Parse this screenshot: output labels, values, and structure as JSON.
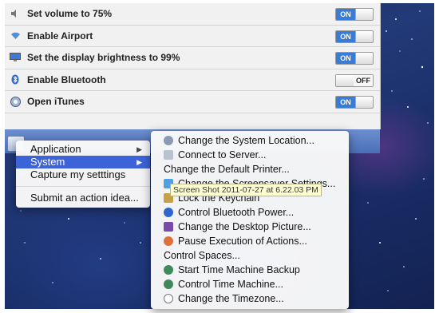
{
  "panel": {
    "rows": [
      {
        "icon": "speaker-icon",
        "label": "Set volume to 75%",
        "toggle": "ON"
      },
      {
        "icon": "airport-icon",
        "label": "Enable Airport",
        "toggle": "ON"
      },
      {
        "icon": "display-icon",
        "label": "Set the display brightness to 99%",
        "toggle": "ON"
      },
      {
        "icon": "bluetooth-icon",
        "label": "Enable Bluetooth",
        "toggle": "OFF"
      },
      {
        "icon": "itunes-icon",
        "label": "Open iTunes",
        "toggle": "ON"
      }
    ]
  },
  "context_menu": {
    "items": [
      {
        "label": "Application",
        "has_submenu": true
      },
      {
        "label": "System",
        "has_submenu": true,
        "selected": true
      },
      {
        "label": "Capture my setttings"
      },
      {
        "label": "Submit an action idea..."
      }
    ]
  },
  "submenu": {
    "items": [
      {
        "label": "Change the System Location...",
        "icon": "network-icon"
      },
      {
        "label": "Connect to Server...",
        "icon": "server-icon"
      },
      {
        "label": "Change the Default Printer..."
      },
      {
        "label": "Change the Screensaver Settings...",
        "icon": "screensaver-icon"
      },
      {
        "label": "Lock the Keychain",
        "icon": "keychain-lock-icon"
      },
      {
        "label": "Control Bluetooth Power...",
        "icon": "bluetooth-icon"
      },
      {
        "label": "Change the Desktop Picture...",
        "icon": "desktop-picture-icon"
      },
      {
        "label": "Pause Execution of Actions...",
        "icon": "pause-icon"
      },
      {
        "label": "Control Spaces..."
      },
      {
        "label": "Start Time Machine Backup",
        "icon": "time-machine-icon"
      },
      {
        "label": "Control Time Machine...",
        "icon": "time-machine-icon"
      },
      {
        "label": "Change the Timezone...",
        "icon": "clock-icon"
      }
    ]
  },
  "tooltip": {
    "text": "Screen Shot 2011-07-27 at 6.22.03 PM"
  },
  "colors": {
    "accent": "#3d63d8",
    "toggle_on": "#3a7bd5"
  }
}
